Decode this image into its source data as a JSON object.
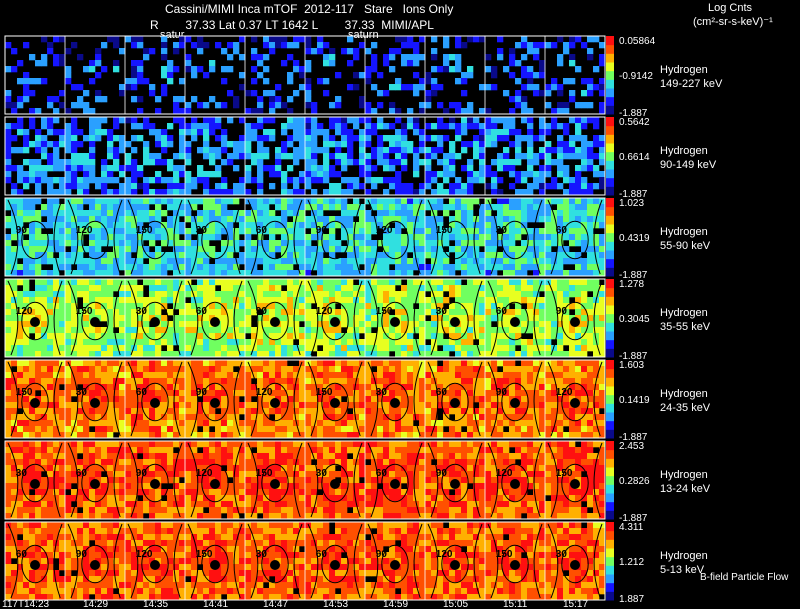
{
  "header": {
    "line1": "Cassini/MIMI Inca mTOF  2012-117   Stare   Ions Only",
    "line2": "R        37.33 Lat 0.37 LT 1642 L        37.33  MIMI/APL",
    "label_a": "satur",
    "label_b": "saturn",
    "legend_title": "Log Cnts",
    "legend_units": "(cm²-sr-s-keV)⁻¹"
  },
  "footer_note": "B-field Particle Flow",
  "chart_data": {
    "type": "heatmap",
    "title": "Cassini/MIMI Inca mTOF  2012-117   Stare   Ions Only",
    "xlabel": "",
    "ylabel": "",
    "time_labels": [
      "117T14:23",
      "14:29",
      "14:35",
      "14:41",
      "14:47",
      "14:53",
      "14:59",
      "15:05",
      "15:11",
      "15:17"
    ],
    "colormap": [
      "#0a0a8a",
      "#1515ff",
      "#2aa0ff",
      "#30e0e0",
      "#70ff60",
      "#e8ff20",
      "#ffb000",
      "#ff5000",
      "#ff1010"
    ],
    "rows": [
      {
        "species": "Hydrogen",
        "energy": "149-227 keV",
        "max": "0.05864",
        "mid": "-0.9142",
        "min": "-1.887"
      },
      {
        "species": "Hydrogen",
        "energy": "90-149 keV",
        "max": "0.5642",
        "mid": "0.6614",
        "min": "-1.887"
      },
      {
        "species": "Hydrogen",
        "energy": "55-90 keV",
        "max": "1.023",
        "mid": "0.4319",
        "min": "-1.887"
      },
      {
        "species": "Hydrogen",
        "energy": "35-55 keV",
        "max": "1.278",
        "mid": "0.3045",
        "min": "-1.887"
      },
      {
        "species": "Hydrogen",
        "energy": "24-35 keV",
        "max": "1.603",
        "mid": "0.1419",
        "min": "-1.887"
      },
      {
        "species": "Hydrogen",
        "energy": "13-24 keV",
        "max": "2.453",
        "mid": "0.2826",
        "min": "-1.887"
      },
      {
        "species": "Hydrogen",
        "energy": "5-13 keV",
        "max": "4.311",
        "mid": "1.212",
        "min": "1.887"
      }
    ],
    "contour_labels": [
      "30",
      "60",
      "90",
      "120",
      "150"
    ]
  }
}
